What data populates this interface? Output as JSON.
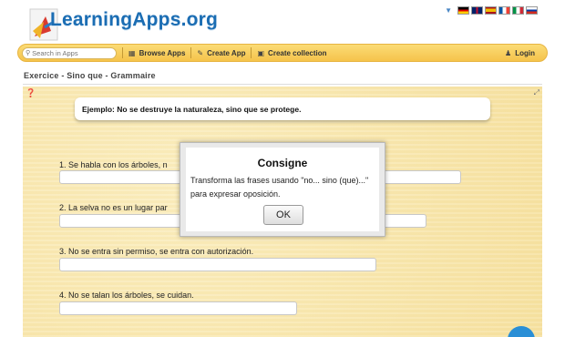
{
  "header": {
    "logo_text": "LearningApps.org",
    "flags": [
      {
        "name": "flag-germany",
        "colors": [
          "#000000",
          "#dd0000",
          "#ffce00"
        ]
      },
      {
        "name": "flag-uk",
        "colors": [
          "#012169",
          "#ffffff",
          "#c8102e"
        ]
      },
      {
        "name": "flag-spain",
        "colors": [
          "#aa151b",
          "#f1bf00",
          "#aa151b"
        ]
      },
      {
        "name": "flag-france",
        "colors": [
          "#0055a4",
          "#ffffff",
          "#ef4135"
        ]
      },
      {
        "name": "flag-italy",
        "colors": [
          "#009246",
          "#ffffff",
          "#ce2b37"
        ]
      },
      {
        "name": "flag-russia",
        "colors": [
          "#ffffff",
          "#0039a6",
          "#d52b1e"
        ]
      }
    ]
  },
  "toolbar": {
    "search_placeholder": "Search in Apps",
    "browse_label": "Browse Apps",
    "create_label": "Create App",
    "collection_label": "Create collection",
    "login_label": "Login"
  },
  "page": {
    "title": "Exercice - Sino que - Grammaire"
  },
  "exercise": {
    "example": "Ejemplo: No se destruye la naturaleza, sino que se protege.",
    "questions": [
      {
        "label": "1. Se habla con los árboles, n"
      },
      {
        "label": "2. La selva no es un lugar par"
      },
      {
        "label": "3. No se entra sin permiso, se entra con autorización."
      },
      {
        "label": "4. No se talan los árboles, se cuidan."
      }
    ]
  },
  "modal": {
    "title": "Consigne",
    "text": "Transforma las frases usando \"no... sino (que)...\" para expresar oposición.",
    "ok_label": "OK"
  },
  "colors": {
    "toolbar": "#f5c34b",
    "logo": "#1b6db3",
    "app_background": "#faeab4"
  }
}
